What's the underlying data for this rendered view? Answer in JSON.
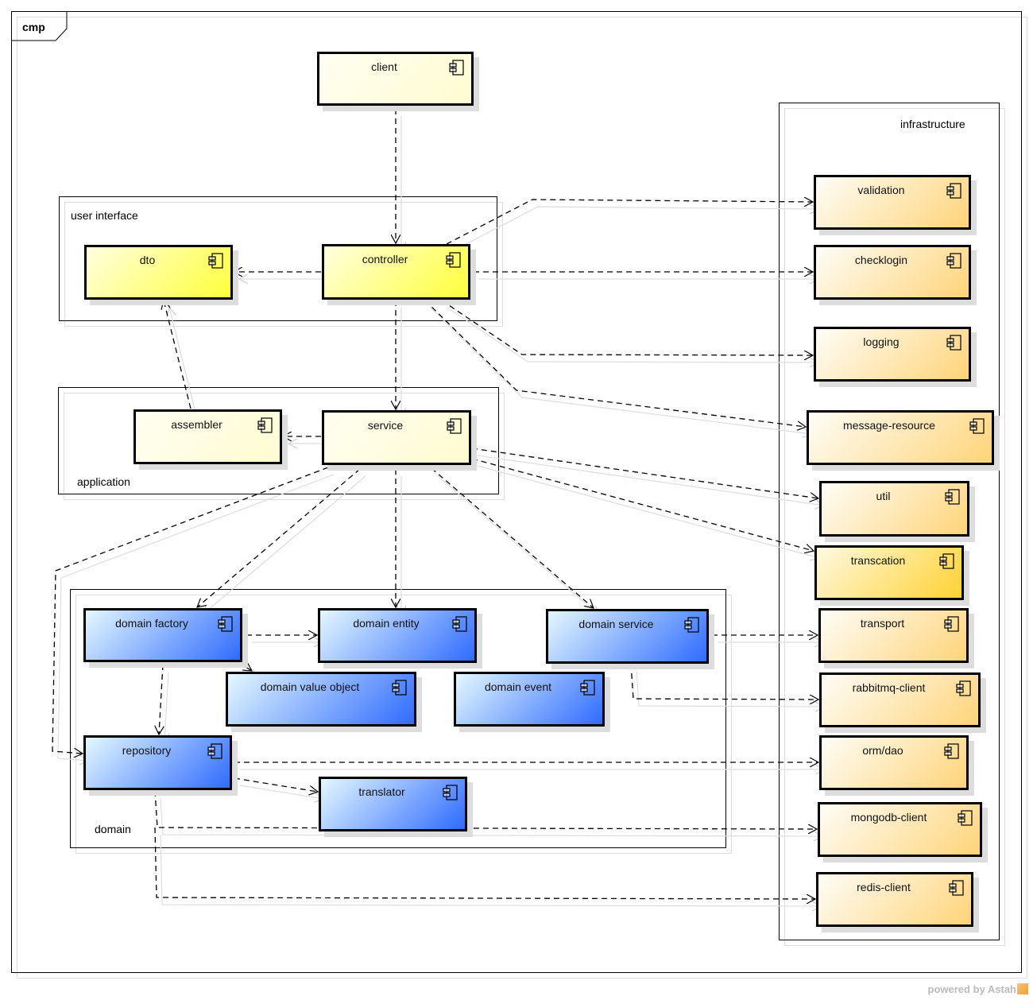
{
  "frame": {
    "label": "cmp"
  },
  "packages": [
    {
      "id": "user-interface",
      "label": "user interface"
    },
    {
      "id": "application",
      "label": "application"
    },
    {
      "id": "domain",
      "label": "domain"
    },
    {
      "id": "infrastructure",
      "label": "infrastructure"
    }
  ],
  "components": [
    {
      "id": "client",
      "label": "client",
      "style": "light-yellow",
      "package": null
    },
    {
      "id": "dto",
      "label": "dto",
      "style": "bright-yellow",
      "package": "user-interface"
    },
    {
      "id": "controller",
      "label": "controller",
      "style": "bright-yellow",
      "package": "user-interface"
    },
    {
      "id": "assembler",
      "label": "assembler",
      "style": "light-yellow",
      "package": "application"
    },
    {
      "id": "service",
      "label": "service",
      "style": "light-yellow",
      "package": "application"
    },
    {
      "id": "domain-factory",
      "label": "domain factory",
      "style": "blue",
      "package": "domain"
    },
    {
      "id": "domain-entity",
      "label": "domain entity",
      "style": "blue",
      "package": "domain"
    },
    {
      "id": "domain-service",
      "label": "domain service",
      "style": "blue",
      "package": "domain"
    },
    {
      "id": "domain-value-object",
      "label": "domain value object",
      "style": "blue",
      "package": "domain"
    },
    {
      "id": "domain-event",
      "label": "domain event",
      "style": "blue",
      "package": "domain"
    },
    {
      "id": "repository",
      "label": "repository",
      "style": "blue",
      "package": "domain"
    },
    {
      "id": "translator",
      "label": "translator",
      "style": "blue",
      "package": "domain"
    },
    {
      "id": "validation",
      "label": "validation",
      "style": "orange",
      "package": "infrastructure"
    },
    {
      "id": "checklogin",
      "label": "checklogin",
      "style": "orange",
      "package": "infrastructure"
    },
    {
      "id": "logging",
      "label": "logging",
      "style": "orange",
      "package": "infrastructure"
    },
    {
      "id": "message-resource",
      "label": "message-resource",
      "style": "orange",
      "package": "infrastructure"
    },
    {
      "id": "util",
      "label": "util",
      "style": "orange",
      "package": "infrastructure"
    },
    {
      "id": "transcation",
      "label": "transcation",
      "style": "gold",
      "package": "infrastructure"
    },
    {
      "id": "transport",
      "label": "transport",
      "style": "orange",
      "package": "infrastructure"
    },
    {
      "id": "rabbitmq-client",
      "label": "rabbitmq-client",
      "style": "orange",
      "package": "infrastructure"
    },
    {
      "id": "orm-dao",
      "label": "orm/dao",
      "style": "orange",
      "package": "infrastructure"
    },
    {
      "id": "mongodb-client",
      "label": "mongodb-client",
      "style": "orange",
      "package": "infrastructure"
    },
    {
      "id": "redis-client",
      "label": "redis-client",
      "style": "orange",
      "package": "infrastructure"
    }
  ],
  "dependencies": [
    {
      "from": "client",
      "to": "controller"
    },
    {
      "from": "controller",
      "to": "dto"
    },
    {
      "from": "controller",
      "to": "validation"
    },
    {
      "from": "controller",
      "to": "checklogin"
    },
    {
      "from": "controller",
      "to": "logging"
    },
    {
      "from": "controller",
      "to": "message-resource"
    },
    {
      "from": "controller",
      "to": "service"
    },
    {
      "from": "assembler",
      "to": "dto"
    },
    {
      "from": "service",
      "to": "assembler"
    },
    {
      "from": "service",
      "to": "util"
    },
    {
      "from": "service",
      "to": "transcation"
    },
    {
      "from": "service",
      "to": "domain-factory"
    },
    {
      "from": "service",
      "to": "domain-entity"
    },
    {
      "from": "service",
      "to": "domain-service"
    },
    {
      "from": "service",
      "to": "repository"
    },
    {
      "from": "domain-factory",
      "to": "domain-entity"
    },
    {
      "from": "domain-factory",
      "to": "domain-value-object"
    },
    {
      "from": "domain-factory",
      "to": "repository"
    },
    {
      "from": "domain-service",
      "to": "transport"
    },
    {
      "from": "domain-service",
      "to": "rabbitmq-client"
    },
    {
      "from": "repository",
      "to": "orm-dao"
    },
    {
      "from": "repository",
      "to": "translator"
    },
    {
      "from": "repository",
      "to": "mongodb-client"
    },
    {
      "from": "repository",
      "to": "redis-client"
    }
  ],
  "colors": {
    "light_yellow": "#fffbd0",
    "bright_yellow": "#ffff3a",
    "orange": "#ffd479",
    "gold": "#ffd233",
    "blue": "#2f6bff",
    "line": "#000000",
    "shadow": "#dddddd"
  },
  "watermark": {
    "text": "powered by Astah"
  }
}
